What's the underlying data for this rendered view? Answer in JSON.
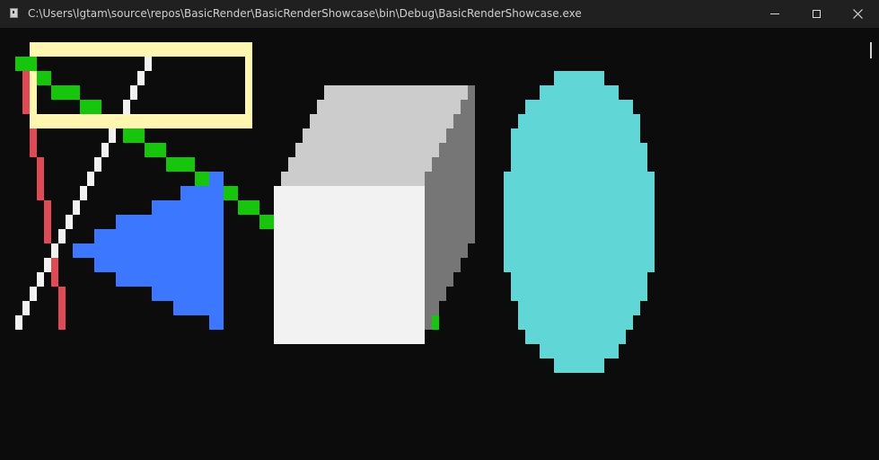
{
  "window": {
    "title": "C:\\Users\\lgtam\\source\\repos\\BasicRender\\BasicRenderShowcase\\bin\\Debug\\BasicRenderShowcase.exe"
  },
  "icons": {
    "app": "console-app-icon",
    "minimize": "minimize-icon",
    "maximize": "maximize-icon",
    "close": "close-icon"
  },
  "colors": {
    "background": "#0c0c0c",
    "titlebar": "#202020",
    "red_line": "#e04a57",
    "white_line": "#f2f2f2",
    "green_line": "#16c60c",
    "blue_triangle": "#3b78ff",
    "yellow_rect": "#fff6b0",
    "cube_front": "#f2f2f2",
    "cube_top": "#cccccc",
    "cube_side": "#767676",
    "cyan_ellipse": "#61d6d6"
  },
  "scene": {
    "shapes": [
      "red-line",
      "white-line",
      "green-line",
      "blue-triangle",
      "yellow-rectangle",
      "gray-cube",
      "cyan-ellipse"
    ]
  }
}
